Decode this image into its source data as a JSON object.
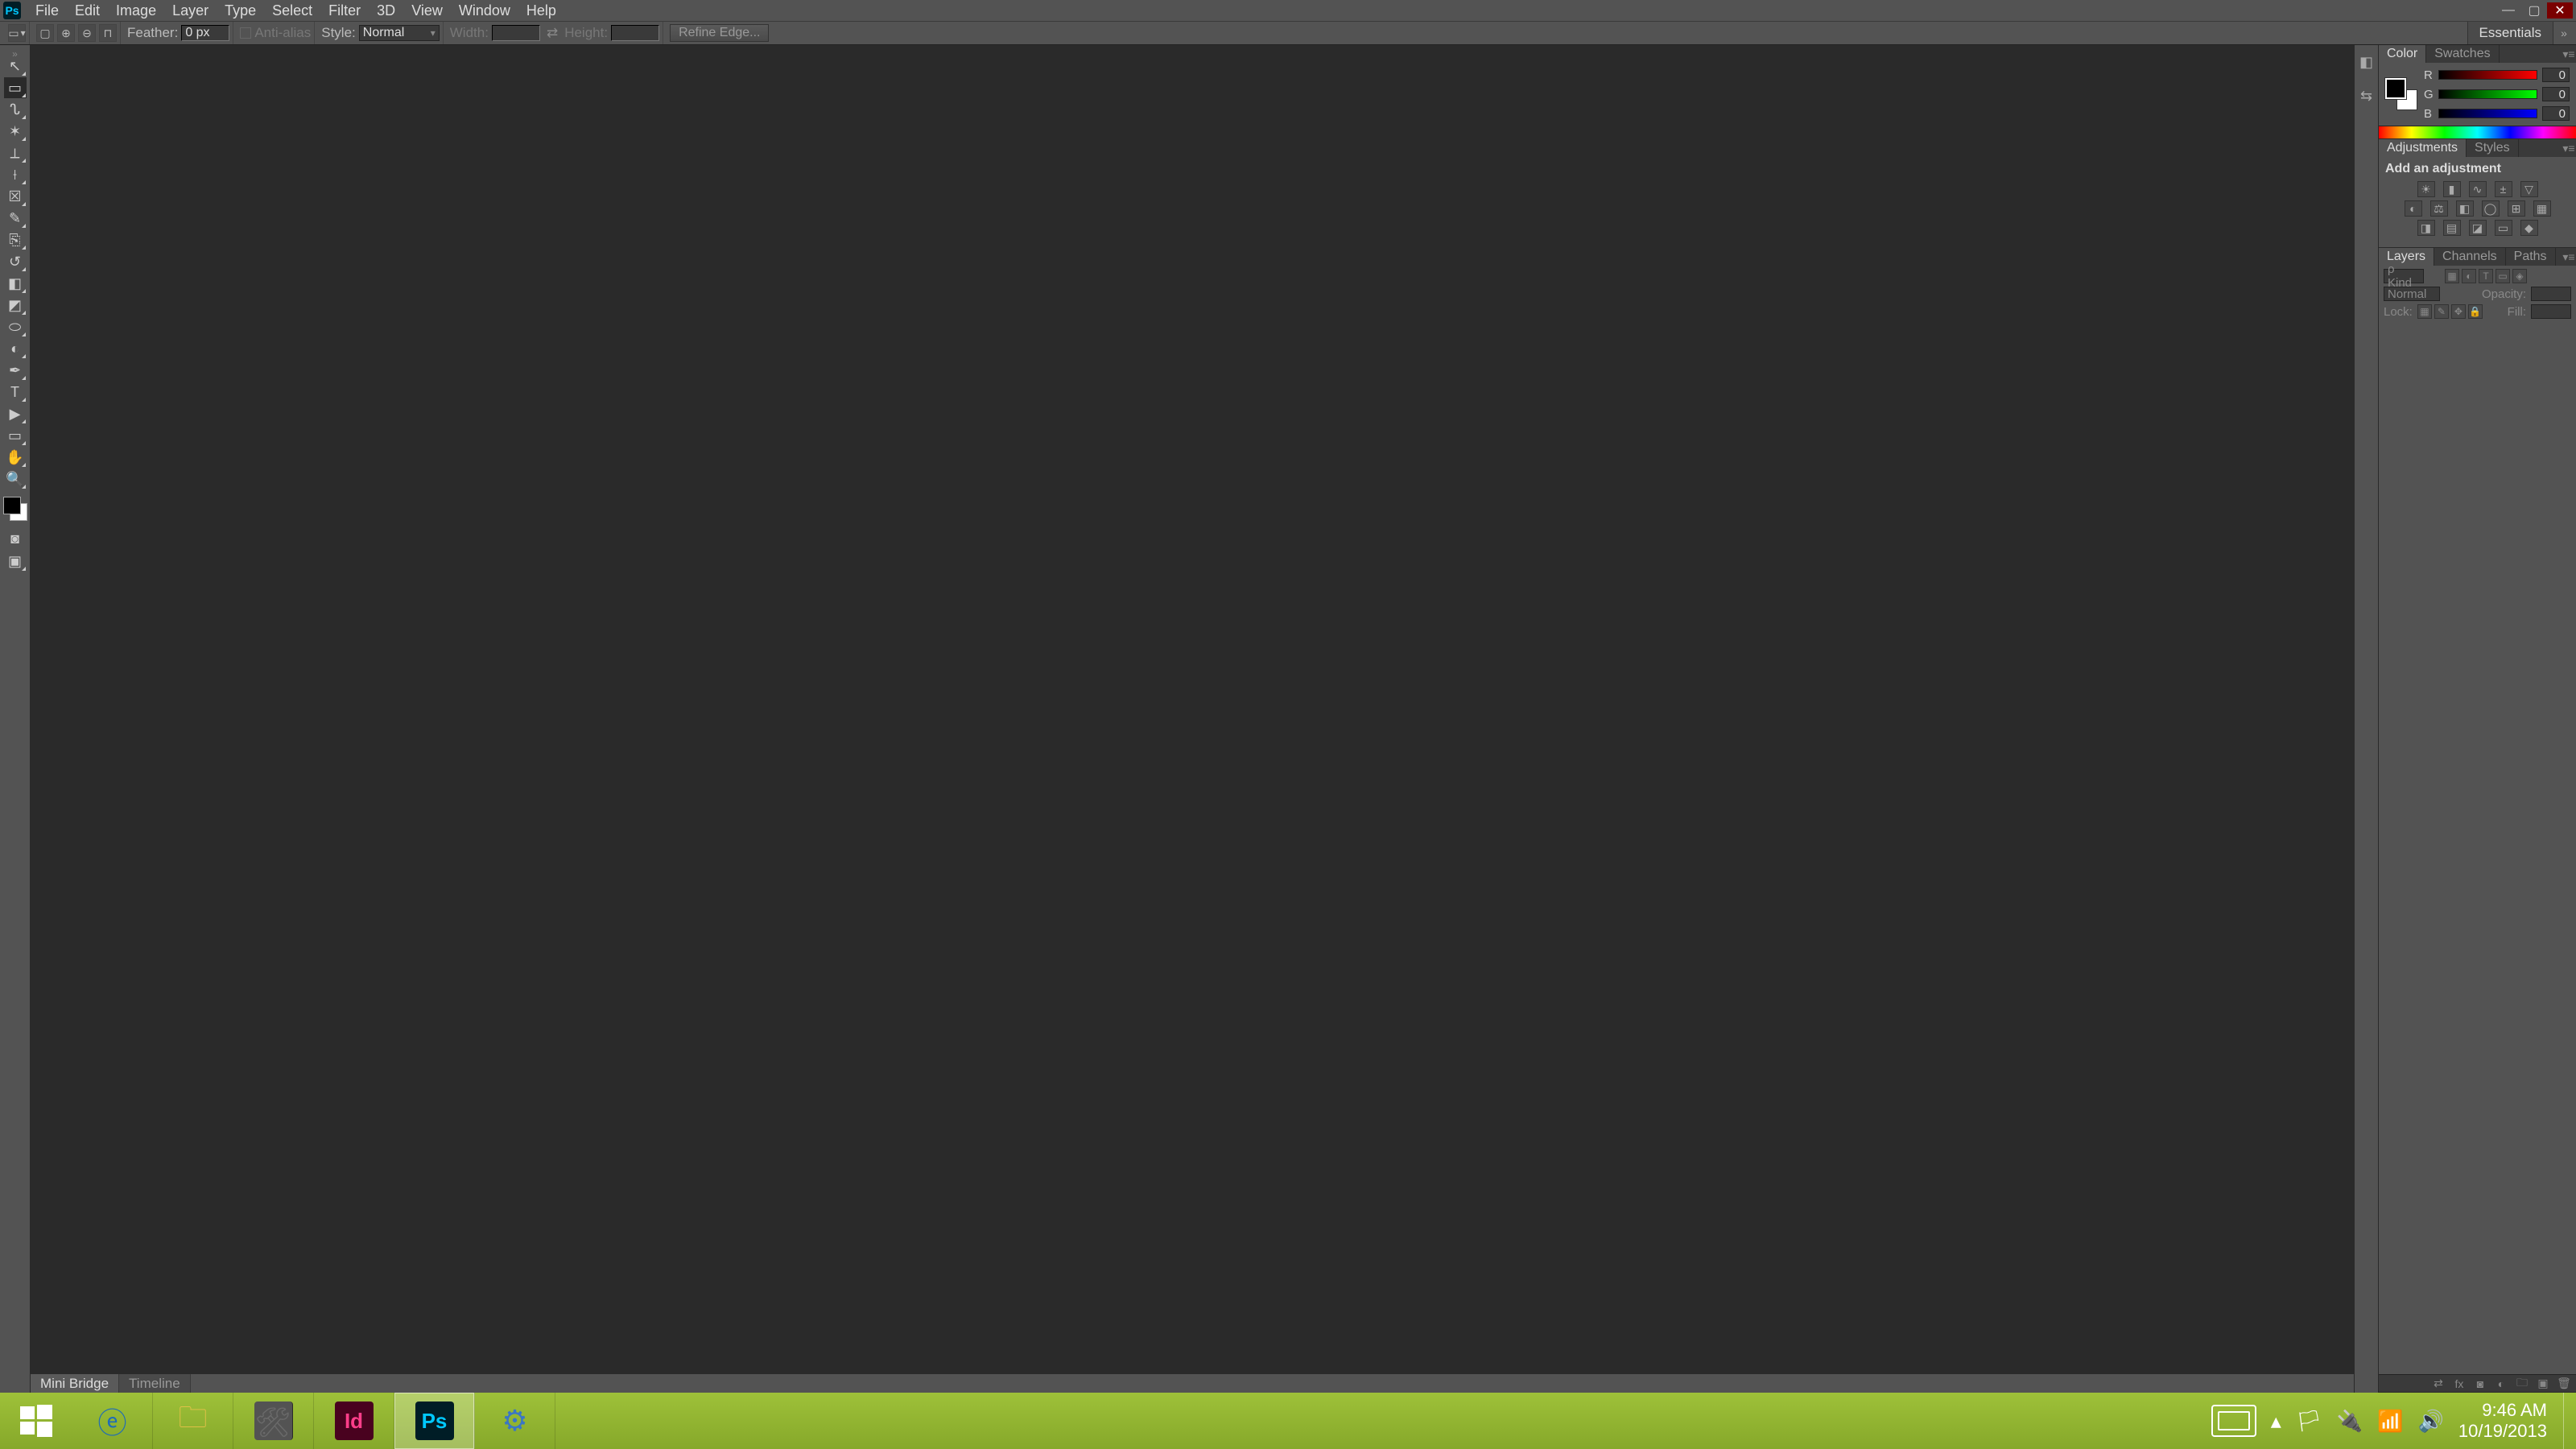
{
  "app": {
    "badge": "Ps"
  },
  "menu": [
    "File",
    "Edit",
    "Image",
    "Layer",
    "Type",
    "Select",
    "Filter",
    "3D",
    "View",
    "Window",
    "Help"
  ],
  "options_bar": {
    "feather_label": "Feather:",
    "feather_value": "0 px",
    "antialias_label": "Anti-alias",
    "style_label": "Style:",
    "style_value": "Normal",
    "width_label": "Width:",
    "height_label": "Height:",
    "refine_label": "Refine Edge..."
  },
  "workspace": {
    "name": "Essentials"
  },
  "tools": [
    {
      "name": "move-tool",
      "glyph": "↖"
    },
    {
      "name": "marquee-tool",
      "glyph": "▭",
      "selected": true
    },
    {
      "name": "lasso-tool",
      "glyph": "ᔐ"
    },
    {
      "name": "quick-select-tool",
      "glyph": "✶"
    },
    {
      "name": "crop-tool",
      "glyph": "⟂"
    },
    {
      "name": "eyedropper-tool",
      "glyph": "⟊"
    },
    {
      "name": "healing-brush-tool",
      "glyph": "☒"
    },
    {
      "name": "brush-tool",
      "glyph": "✎"
    },
    {
      "name": "clone-stamp-tool",
      "glyph": "⎘"
    },
    {
      "name": "history-brush-tool",
      "glyph": "↺"
    },
    {
      "name": "eraser-tool",
      "glyph": "◧"
    },
    {
      "name": "gradient-tool",
      "glyph": "◩"
    },
    {
      "name": "blur-tool",
      "glyph": "⬭"
    },
    {
      "name": "dodge-tool",
      "glyph": "◐"
    },
    {
      "name": "pen-tool",
      "glyph": "✒"
    },
    {
      "name": "type-tool",
      "glyph": "T"
    },
    {
      "name": "path-select-tool",
      "glyph": "▶"
    },
    {
      "name": "shape-tool",
      "glyph": "▭"
    },
    {
      "name": "hand-tool",
      "glyph": "✋"
    },
    {
      "name": "zoom-tool",
      "glyph": "🔍"
    }
  ],
  "bottom_tabs": {
    "mini_bridge": "Mini Bridge",
    "timeline": "Timeline"
  },
  "panels": {
    "color": {
      "tabs": [
        "Color",
        "Swatches"
      ],
      "r_label": "R",
      "g_label": "G",
      "b_label": "B",
      "r_value": "0",
      "g_value": "0",
      "b_value": "0",
      "fg_color": "#000000",
      "bg_color": "#ffffff"
    },
    "adjustments": {
      "tabs": [
        "Adjustments",
        "Styles"
      ],
      "header": "Add an adjustment"
    },
    "layers": {
      "tabs": [
        "Layers",
        "Channels",
        "Paths"
      ],
      "kind_label": "ρ Kind",
      "blend_mode": "Normal",
      "opacity_label": "Opacity:",
      "lock_label": "Lock:",
      "fill_label": "Fill:"
    }
  },
  "taskbar": {
    "id_label": "Id",
    "ps_label": "Ps",
    "clock_time": "9:46 AM",
    "clock_date": "10/19/2013"
  }
}
